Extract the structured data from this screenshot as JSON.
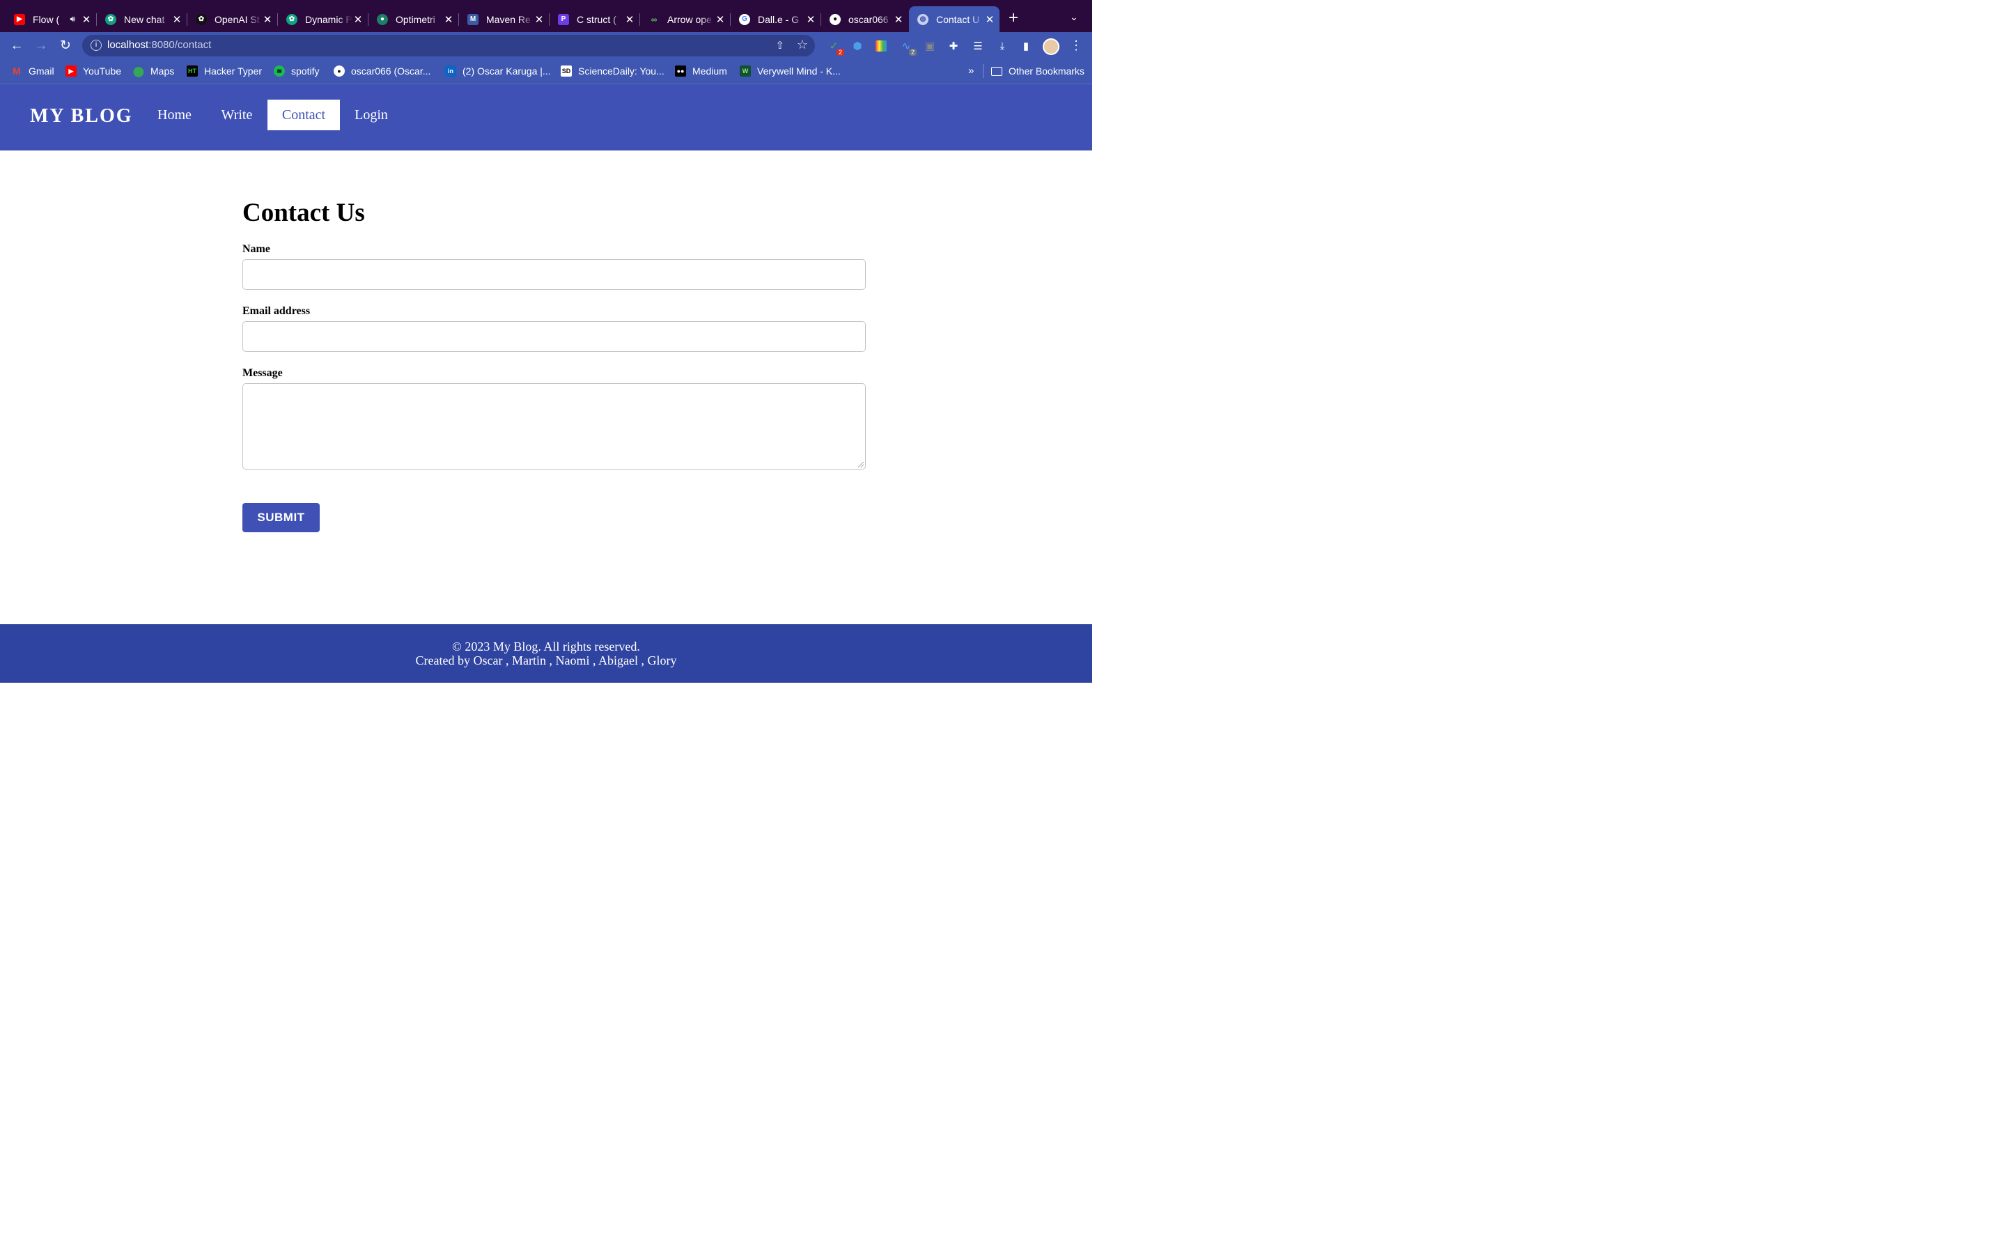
{
  "browser": {
    "tabs": [
      {
        "title": "Flow (",
        "icon": "youtube-icon",
        "color": "#ff0000",
        "audio": true
      },
      {
        "title": "New chat",
        "icon": "chatgpt-icon",
        "color": "#10a37f"
      },
      {
        "title": "OpenAI St",
        "icon": "openai-icon",
        "color": "#111111"
      },
      {
        "title": "Dynamic P",
        "icon": "chatgpt-icon",
        "color": "#10a37f"
      },
      {
        "title": "Optimetri",
        "icon": "optimetrics-icon",
        "color": "#1a7f64"
      },
      {
        "title": "Maven Re",
        "icon": "maven-icon",
        "color": "#3b5ba5"
      },
      {
        "title": "C struct (",
        "icon": "programiz-icon",
        "color": "#6a3de8"
      },
      {
        "title": "Arrow ope",
        "icon": "arrow-icon",
        "color": "#3a8f3a"
      },
      {
        "title": "Dall.e - G",
        "icon": "google-icon",
        "color": "#ffffff"
      },
      {
        "title": "oscar066",
        "icon": "github-icon",
        "color": "#ffffff"
      },
      {
        "title": "Contact U",
        "icon": "globe-icon",
        "color": "#c9d0ee",
        "active": true
      }
    ],
    "address": {
      "host": "localhost",
      "path": ":8080/contact"
    },
    "bookmarks": [
      {
        "label": "Gmail",
        "icon": "gmail-icon"
      },
      {
        "label": "YouTube",
        "icon": "youtube-icon"
      },
      {
        "label": "Maps",
        "icon": "maps-icon"
      },
      {
        "label": "Hacker Typer",
        "icon": "hackertyper-icon"
      },
      {
        "label": "spotify",
        "icon": "spotify-icon"
      },
      {
        "label": "oscar066 (Oscar...",
        "icon": "github-icon"
      },
      {
        "label": "(2) Oscar Karuga |...",
        "icon": "linkedin-icon"
      },
      {
        "label": "ScienceDaily: You...",
        "icon": "sciencedaily-icon"
      },
      {
        "label": "Medium",
        "icon": "medium-icon"
      },
      {
        "label": "Verywell Mind - K...",
        "icon": "verywell-icon"
      }
    ],
    "other_bookmarks": "Other Bookmarks",
    "extension_badges": {
      "first": "2",
      "second": "2"
    },
    "theme_color": "#3f57b0",
    "tabstrip_color": "#2a0a3c"
  },
  "site": {
    "logo": "MY BLOG",
    "nav": [
      {
        "label": "Home"
      },
      {
        "label": "Write"
      },
      {
        "label": "Contact",
        "active": true
      },
      {
        "label": "Login"
      }
    ],
    "brand_color": "#3f51b5"
  },
  "contact": {
    "heading": "Contact Us",
    "name_label": "Name",
    "name_value": "",
    "email_label": "Email address",
    "email_value": "",
    "message_label": "Message",
    "message_value": "",
    "submit_label": "SUBMIT"
  },
  "footer": {
    "copyright": "© 2023 My Blog. All rights reserved.",
    "credits": "Created by Oscar , Martin , Naomi , Abigael , Glory"
  }
}
